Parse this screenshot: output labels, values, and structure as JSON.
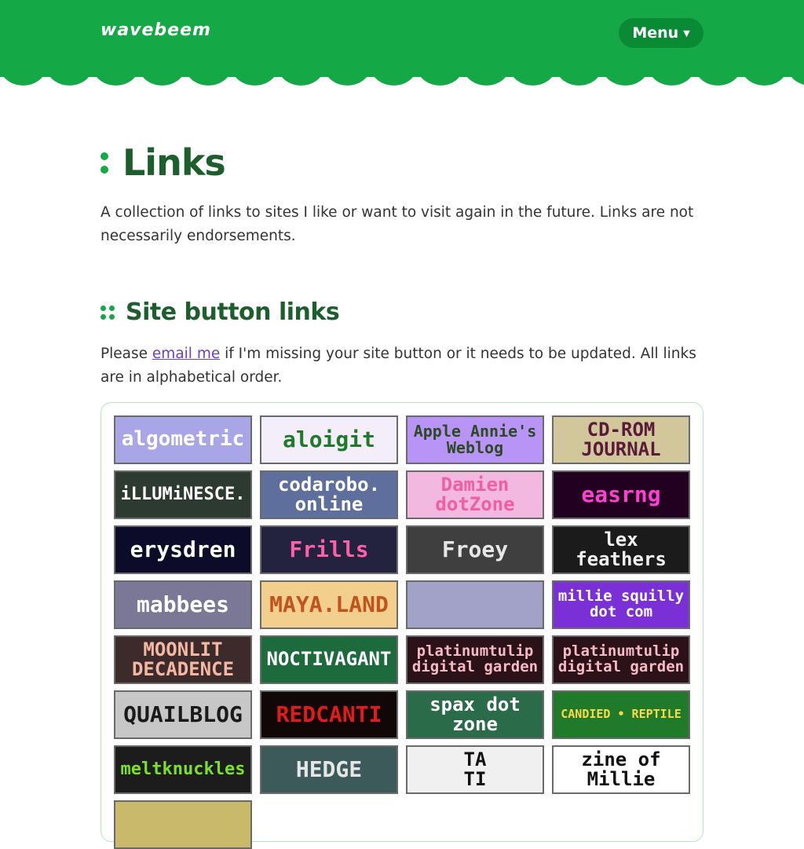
{
  "header": {
    "logo": "wavebeem",
    "menu_label": "Menu"
  },
  "page": {
    "title": "Links",
    "intro": "A collection of links to sites I like or want to visit again in the future. Links are not necessarily endorsements."
  },
  "section": {
    "title": "Site button links",
    "desc_before": "Please ",
    "desc_link": "email me",
    "desc_after": " if I'm missing your site button or it needs to be updated. All links are in alphabetical order."
  },
  "buttons": [
    {
      "text": "algometric",
      "bg": "#a9a6e8",
      "fg": "#ffffff"
    },
    {
      "text": "aloigit",
      "bg": "#f4eefa",
      "fg": "#1f7a2a"
    },
    {
      "text": "Apple Annie's\nWeblog",
      "bg": "#b794f6",
      "fg": "#2d4a25"
    },
    {
      "text": "CD-ROM\nJOURNAL",
      "bg": "#d2c79a",
      "fg": "#5a1a3a"
    },
    {
      "text": "iLLUMiNESCE.",
      "bg": "#2d3a32",
      "fg": "#ffffff"
    },
    {
      "text": "codarobo.\nonline",
      "bg": "#5f6f9d",
      "fg": "#ffffff"
    },
    {
      "text": "Damien\ndotZone",
      "bg": "#f2b8e0",
      "fg": "#f05f9f"
    },
    {
      "text": "easrng",
      "bg": "#22001f",
      "fg": "#ff3fd2"
    },
    {
      "text": "erysdren",
      "bg": "#0c0c2a",
      "fg": "#ffffff"
    },
    {
      "text": "Frills",
      "bg": "#23233f",
      "fg": "#ff5fa8"
    },
    {
      "text": "Froey",
      "bg": "#3f3f3f",
      "fg": "#e6e6e6"
    },
    {
      "text": "lex\nfeathers",
      "bg": "#1b1b1b",
      "fg": "#f0f0f0"
    },
    {
      "text": "mabbees",
      "bg": "#7a7797",
      "fg": "#ffffff"
    },
    {
      "text": "MAYA.LAND",
      "bg": "#f2cf8c",
      "fg": "#c1531e"
    },
    {
      "text": "",
      "bg": "#a2a2c8",
      "fg": "#111111"
    },
    {
      "text": "millie squilly\ndot com",
      "bg": "#7b2fd6",
      "fg": "#ffffff"
    },
    {
      "text": "MOONLIT\nDECADENCE",
      "bg": "#3d2b2b",
      "fg": "#f4b7a2"
    },
    {
      "text": "NOCTIVAGANT",
      "bg": "#1d6b3d",
      "fg": "#ffffff"
    },
    {
      "text": "platinumtulip\ndigital garden",
      "bg": "#2a1218",
      "fg": "#f7b9c6"
    },
    {
      "text": "platinumtulip\ndigital garden",
      "bg": "#2a1218",
      "fg": "#f7b9c6"
    },
    {
      "text": "QUAILBLOG",
      "bg": "#c7c7c7",
      "fg": "#1a1a1a"
    },
    {
      "text": "REDCANTI",
      "bg": "#120707",
      "fg": "#e21a1a"
    },
    {
      "text": "spax dot\nzone",
      "bg": "#2a6b4a",
      "fg": "#ffffff"
    },
    {
      "text": "CANDIED • REPTILE",
      "bg": "#1f7a2a",
      "fg": "#ffd84a"
    },
    {
      "text": "meltknuckles",
      "bg": "#1c1c1c",
      "fg": "#7ce02a"
    },
    {
      "text": "HEDGE",
      "bg": "#3c5a5a",
      "fg": "#e6e6e6"
    },
    {
      "text": "TA\nTI",
      "bg": "#f0f0f0",
      "fg": "#111111"
    },
    {
      "text": "zine of\nMillie",
      "bg": "#ffffff",
      "fg": "#111111"
    }
  ]
}
